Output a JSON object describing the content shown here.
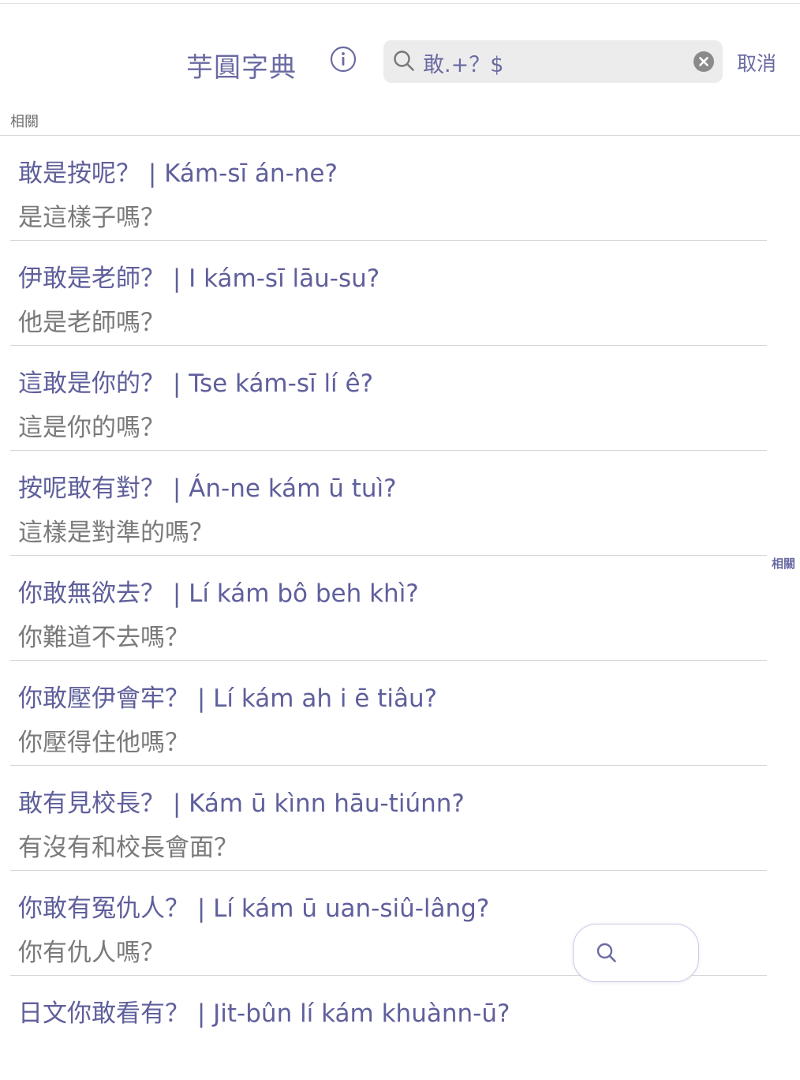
{
  "header": {
    "app_title": "芋圓字典",
    "search_value": "敢.+？$",
    "cancel_label": "取消"
  },
  "section": {
    "label": "相關",
    "side_index": "相關"
  },
  "results": [
    {
      "title": "敢是按呢？ | Kám-sī án-ne?",
      "gloss": "是這樣子嗎？"
    },
    {
      "title": "伊敢是老師？ | I kám-sī lāu-su?",
      "gloss": "他是老師嗎？"
    },
    {
      "title": "這敢是你的？ | Tse kám-sī lí ê?",
      "gloss": "這是你的嗎？"
    },
    {
      "title": "按呢敢有對？ | Án-ne kám ū tuì?",
      "gloss": "這樣是對準的嗎？"
    },
    {
      "title": "你敢無欲去？ | Lí kám bô beh khì?",
      "gloss": "你難道不去嗎？"
    },
    {
      "title": "你敢壓伊會牢？ | Lí kám ah i ē tiâu?",
      "gloss": "你壓得住他嗎？"
    },
    {
      "title": "敢有見校長？ | Kám ū kìnn hāu-tiúnn?",
      "gloss": "有沒有和校長會面？"
    },
    {
      "title": "你敢有冤仇人？ | Lí kám ū uan-siû-lâng?",
      "gloss": "你有仇人嗎？"
    },
    {
      "title": "日文你敢看有？ | Jit-bûn lí kám khuànn-ū?",
      "gloss": ""
    }
  ],
  "icons": {
    "info": "info-circle-icon",
    "search": "magnifier-icon",
    "clear": "clear-x-circle-icon",
    "fab": "magnifier-icon"
  },
  "colors": {
    "accent": "#6b6ba3",
    "title_text": "#5f5f9c",
    "gloss_text": "#7a7a7a",
    "search_bg": "#ececec",
    "divider": "#d6d6d6"
  }
}
